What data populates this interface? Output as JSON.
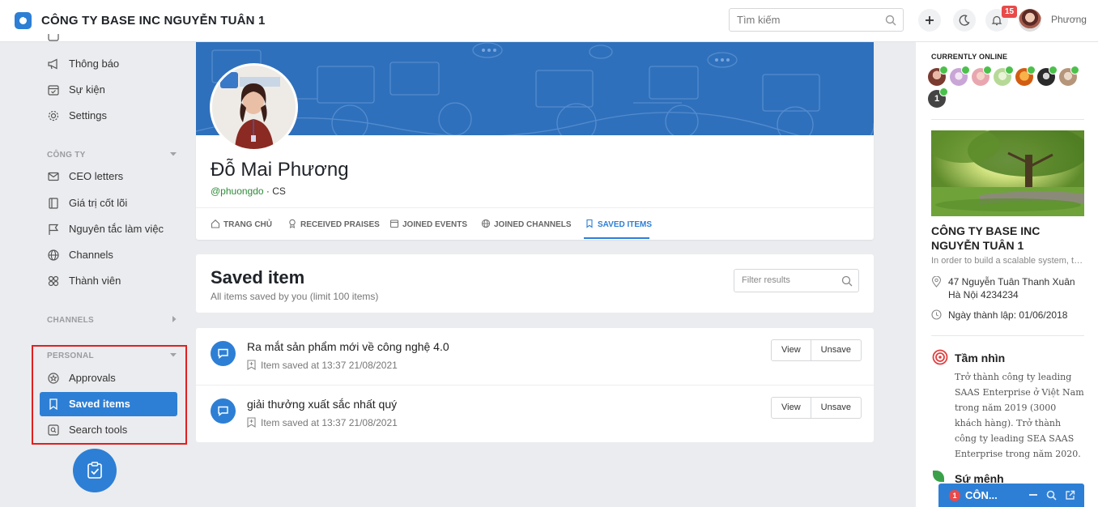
{
  "header": {
    "company_name": "CÔNG TY BASE INC NGUYỄN TUÂN 1",
    "search_placeholder": "Tìm kiếm",
    "notification_count": "15",
    "user_name": "Phương",
    "icons": [
      "base-logo-icon",
      "search-icon",
      "plus-icon",
      "moon-icon",
      "bell-icon"
    ]
  },
  "sidebar": {
    "top_items": [
      {
        "label": "Thông báo",
        "icon": "megaphone-icon"
      },
      {
        "label": "Sự kiện",
        "icon": "calendar-icon"
      },
      {
        "label": "Settings",
        "icon": "gear-icon"
      }
    ],
    "company_header": "CÔNG TY",
    "company_items": [
      {
        "label": "CEO letters",
        "icon": "mail-icon"
      },
      {
        "label": "Giá trị cốt lõi",
        "icon": "book-icon"
      },
      {
        "label": "Nguyên tắc làm việc",
        "icon": "flag-icon"
      },
      {
        "label": "Channels",
        "icon": "globe-icon"
      },
      {
        "label": "Thành viên",
        "icon": "members-icon"
      }
    ],
    "channels_header": "CHANNELS",
    "personal_header": "PERSONAL",
    "personal_items": [
      {
        "label": "Approvals",
        "icon": "star-badge-icon"
      },
      {
        "label": "Saved items",
        "icon": "bookmark-icon",
        "active": true
      },
      {
        "label": "Search tools",
        "icon": "search-tool-icon"
      }
    ]
  },
  "profile": {
    "name": "Đỗ Mai Phương",
    "handle": "@phuongdo",
    "role": " · CS",
    "tabs": [
      {
        "label": "TRANG CHỦ",
        "icon": "home-icon"
      },
      {
        "label": "RECEIVED PRAISES",
        "icon": "award-icon"
      },
      {
        "label": "JOINED EVENTS",
        "icon": "calendar-icon"
      },
      {
        "label": "JOINED CHANNELS",
        "icon": "globe-icon"
      },
      {
        "label": "SAVED ITEMS",
        "icon": "bookmark-icon",
        "active": true
      }
    ]
  },
  "saved": {
    "title": "Saved item",
    "subtitle": "All items saved by you (limit 100 items)",
    "filter_placeholder": "Filter results",
    "view_label": "View",
    "unsave_label": "Unsave",
    "items": [
      {
        "title": "Ra mắt sản phẩm mới về công nghệ 4.0",
        "meta": "Item saved at 13:37 21/08/2021"
      },
      {
        "title": "giải thưởng xuất sắc nhất quý",
        "meta": "Item saved at 13:37 21/08/2021"
      }
    ]
  },
  "right_panel": {
    "online_label": "CURRENTLY ONLINE",
    "online_extra_count": "1",
    "company_name": "CÔNG TY BASE INC NGUYỄN TUÂN 1",
    "company_desc": "In order to build a scalable system, th...",
    "address": "47 Nguyễn Tuân Thanh Xuân Hà Nội 4234234",
    "founded": "Ngày thành lập: 01/06/2018",
    "vision_title": "Tầm nhìn",
    "vision_text": "Trở thành công ty leading SAAS Enterprise ở Việt Nam trong năm 2019 (3000 khách hàng). Trở thành công ty leading SEA SAAS Enterprise trong năm 2020.",
    "mission_title": "Sứ mệnh"
  },
  "chat": {
    "unread": "1",
    "name": "CÔN..."
  },
  "colors": {
    "accent": "#2d7fd5",
    "online": "#4bc04b",
    "badge": "#e84a4a",
    "highlight": "#e02020"
  }
}
